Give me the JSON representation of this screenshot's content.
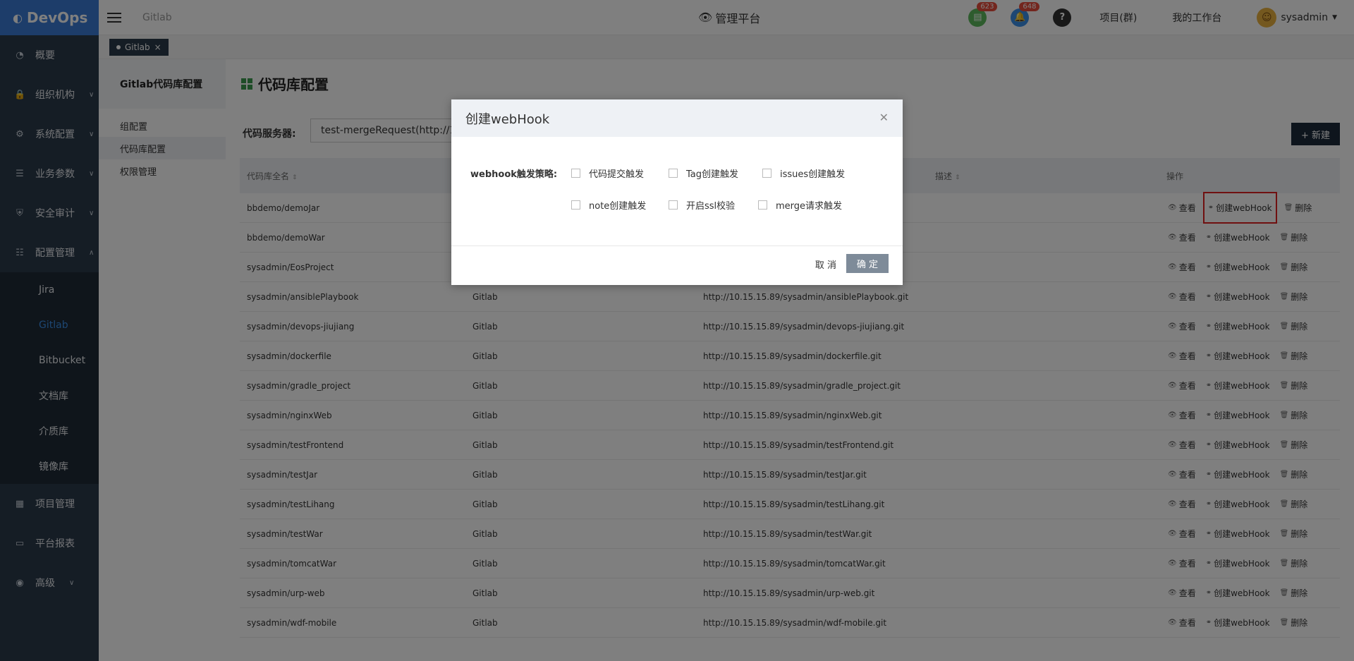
{
  "app": {
    "logo": "DevOps"
  },
  "sidebar": {
    "items": [
      {
        "label": "概要",
        "icon": "dashboard-icon",
        "chevron": ""
      },
      {
        "label": "组织机构",
        "icon": "lock-icon",
        "chevron": "down"
      },
      {
        "label": "系统配置",
        "icon": "gear-icon",
        "chevron": "down"
      },
      {
        "label": "业务参数",
        "icon": "sliders-icon",
        "chevron": "down"
      },
      {
        "label": "安全审计",
        "icon": "shield-icon",
        "chevron": "down"
      },
      {
        "label": "配置管理",
        "icon": "database-icon",
        "chevron": "up"
      }
    ],
    "submenu": [
      "Jira",
      "Gitlab",
      "Bitbucket",
      "文档库",
      "介质库",
      "镜像库"
    ],
    "submenu_active": "Gitlab",
    "bottom_items": [
      {
        "label": "项目管理",
        "icon": "grid-icon",
        "chevron": ""
      },
      {
        "label": "平台报表",
        "icon": "monitor-icon",
        "chevron": ""
      },
      {
        "label": "高级",
        "icon": "palette-icon",
        "chevron": "down"
      }
    ]
  },
  "header": {
    "breadcrumb": "Gitlab",
    "platform": "管理平台",
    "badge_tasks": "623",
    "badge_notifications": "648",
    "help": "?",
    "project_group": "项目(群)",
    "workspace": "我的工作台",
    "user": "sysadmin"
  },
  "tabs": [
    {
      "label": "Gitlab",
      "close": "×"
    }
  ],
  "subsidebar": {
    "title": "Gitlab代码库配置",
    "items": [
      "组配置",
      "代码库配置",
      "权限管理"
    ],
    "active": "代码库配置"
  },
  "main": {
    "title": "代码库配置",
    "server_label": "代码服务器:",
    "server_value": "test-mergeRequest(http://1",
    "new_button": "+ 新建",
    "columns": [
      "代码库全名",
      "",
      "",
      "描述",
      "操作"
    ],
    "actions": {
      "view": "查看",
      "webhook": "创建webHook",
      "delete": "删除"
    },
    "rows": [
      {
        "name": "bbdemo/demoJar",
        "type": "",
        "url": ""
      },
      {
        "name": "bbdemo/demoWar",
        "type": "",
        "url": ""
      },
      {
        "name": "sysadmin/EosProject",
        "type": "",
        "url": ""
      },
      {
        "name": "sysadmin/ansiblePlaybook",
        "type": "Gitlab",
        "url": "http://10.15.15.89/sysadmin/ansiblePlaybook.git"
      },
      {
        "name": "sysadmin/devops-jiujiang",
        "type": "Gitlab",
        "url": "http://10.15.15.89/sysadmin/devops-jiujiang.git"
      },
      {
        "name": "sysadmin/dockerfile",
        "type": "Gitlab",
        "url": "http://10.15.15.89/sysadmin/dockerfile.git"
      },
      {
        "name": "sysadmin/gradle_project",
        "type": "Gitlab",
        "url": "http://10.15.15.89/sysadmin/gradle_project.git"
      },
      {
        "name": "sysadmin/nginxWeb",
        "type": "Gitlab",
        "url": "http://10.15.15.89/sysadmin/nginxWeb.git"
      },
      {
        "name": "sysadmin/testFrontend",
        "type": "Gitlab",
        "url": "http://10.15.15.89/sysadmin/testFrontend.git"
      },
      {
        "name": "sysadmin/testJar",
        "type": "Gitlab",
        "url": "http://10.15.15.89/sysadmin/testJar.git"
      },
      {
        "name": "sysadmin/testLihang",
        "type": "Gitlab",
        "url": "http://10.15.15.89/sysadmin/testLihang.git"
      },
      {
        "name": "sysadmin/testWar",
        "type": "Gitlab",
        "url": "http://10.15.15.89/sysadmin/testWar.git"
      },
      {
        "name": "sysadmin/tomcatWar",
        "type": "Gitlab",
        "url": "http://10.15.15.89/sysadmin/tomcatWar.git"
      },
      {
        "name": "sysadmin/urp-web",
        "type": "Gitlab",
        "url": "http://10.15.15.89/sysadmin/urp-web.git"
      },
      {
        "name": "sysadmin/wdf-mobile",
        "type": "Gitlab",
        "url": "http://10.15.15.89/sysadmin/wdf-mobile.git"
      }
    ]
  },
  "modal": {
    "title": "创建webHook",
    "strategy_label": "webhook触发策略:",
    "checkboxes": [
      {
        "label": "代码提交触发",
        "checked": false
      },
      {
        "label": "Tag创建触发",
        "checked": false
      },
      {
        "label": "issues创建触发",
        "checked": false
      },
      {
        "label": "note创建触发",
        "checked": false
      },
      {
        "label": "开启ssl校验",
        "checked": false
      },
      {
        "label": "merge请求触发",
        "checked": false
      }
    ],
    "cancel": "取 消",
    "confirm": "确 定"
  }
}
